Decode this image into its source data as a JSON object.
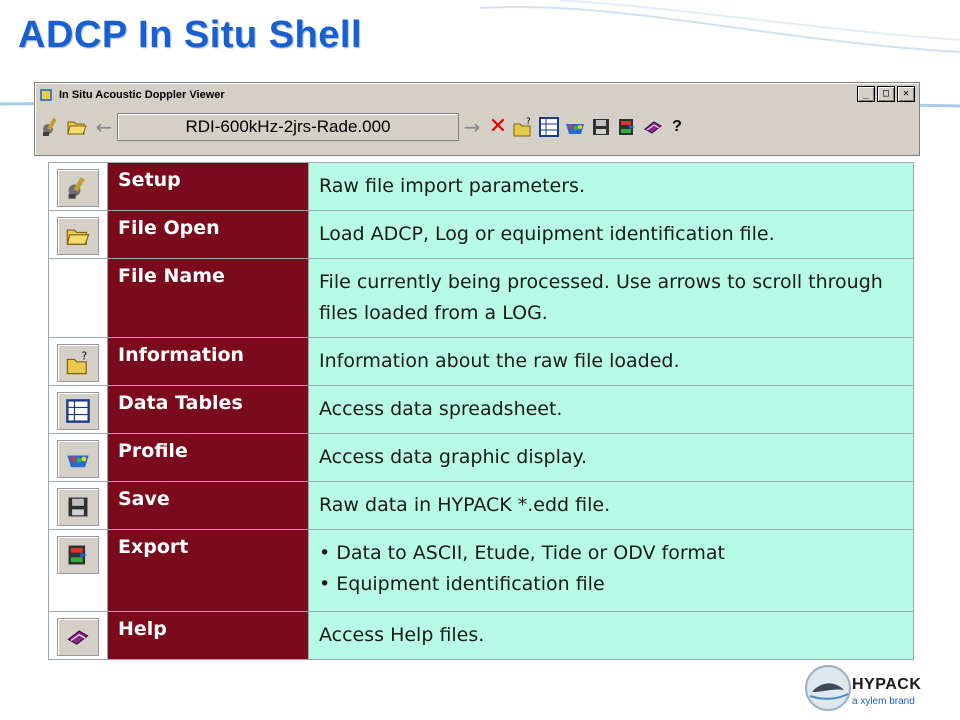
{
  "slide": {
    "title": "ADCP In Situ Shell"
  },
  "window": {
    "title": "In Situ Acoustic Doppler Viewer",
    "buttons": [
      "_",
      "□",
      "✕"
    ],
    "toolbar": {
      "file_name": "RDI-600kHz-2jrs-Rade.000",
      "help_label": "?"
    }
  },
  "table": {
    "rows": [
      {
        "icon": "setup-icon",
        "name": "Setup",
        "desc": [
          "Raw file import parameters."
        ]
      },
      {
        "icon": "folder-open-icon",
        "name": "File Open",
        "desc": [
          "Load ADCP, Log or equipment identification file."
        ]
      },
      {
        "icon": "",
        "name": "File Name",
        "desc": [
          "File currently being processed. Use arrows to scroll through files loaded from a LOG."
        ]
      },
      {
        "icon": "information-icon",
        "name": "Information",
        "desc": [
          "Information about the raw file loaded."
        ]
      },
      {
        "icon": "data-tables-icon",
        "name": "Data Tables",
        "desc": [
          "Access data spreadsheet."
        ]
      },
      {
        "icon": "profile-icon",
        "name": "Profile",
        "desc": [
          "Access data graphic display."
        ]
      },
      {
        "icon": "save-icon",
        "name": "Save",
        "desc": [
          "Raw data in HYPACK *.edd file."
        ]
      },
      {
        "icon": "export-icon",
        "name": "Export",
        "bullets": [
          "Data to ASCII, Etude, Tide or ODV format",
          "Equipment identification file"
        ]
      },
      {
        "icon": "help-book-icon",
        "name": "Help",
        "desc": [
          "Access Help files."
        ]
      }
    ]
  },
  "logo": {
    "name": "HYPACK",
    "sub": "a xylem brand"
  },
  "colors": {
    "title": "#1a5fd0",
    "name_cell": "#7b0a1c",
    "desc_cell": "#b7fbe7"
  }
}
